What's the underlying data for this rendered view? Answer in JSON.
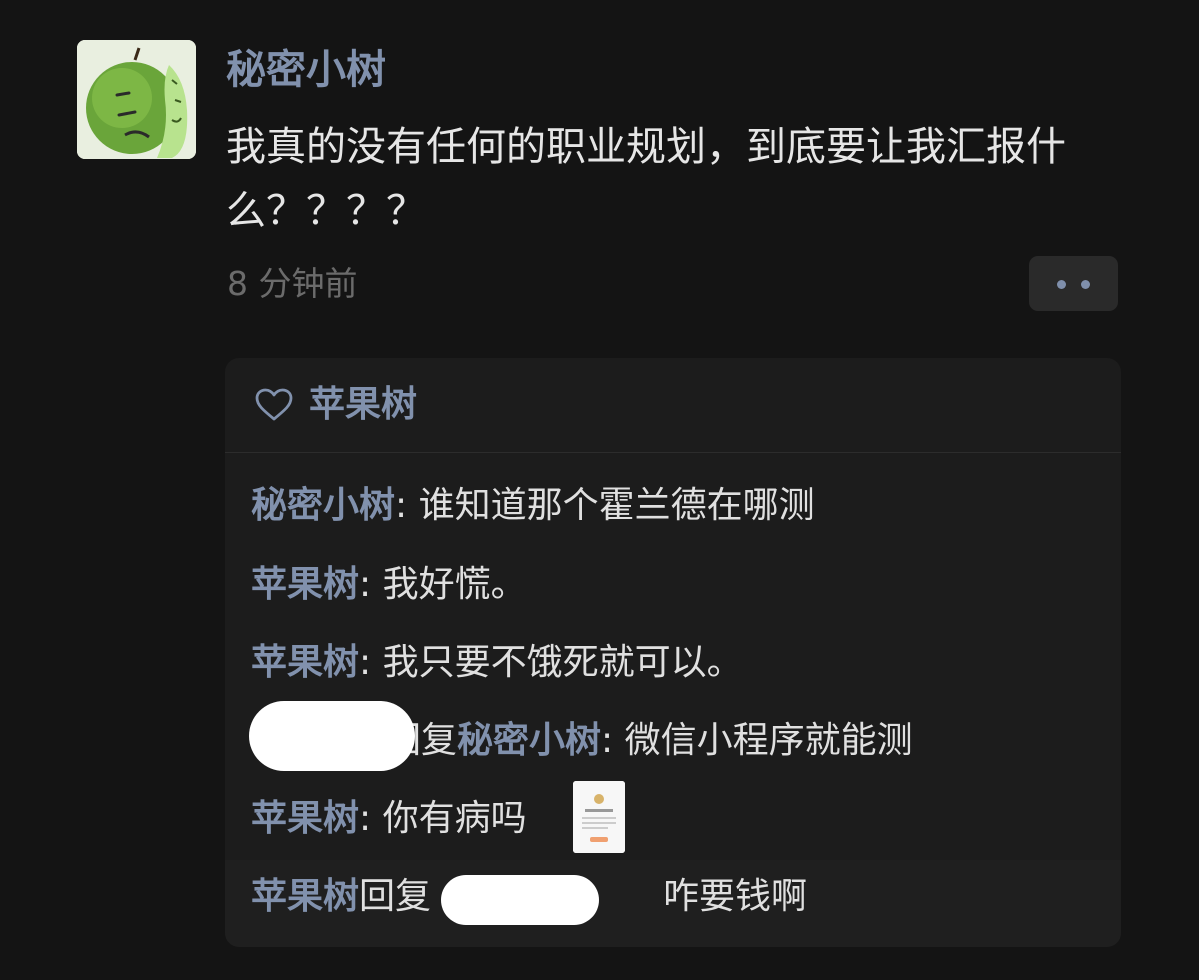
{
  "post": {
    "author": "秘密小树",
    "text": "我真的没有任何的职业规划，到底要让我汇报什么？？？？",
    "time": "8 分钟前"
  },
  "likes": {
    "names": "苹果树"
  },
  "comments": [
    {
      "name": "秘密小树",
      "sep": ": ",
      "text": "谁知道那个霍兰德在哪测"
    },
    {
      "name": "苹果树",
      "sep": ": ",
      "text": "我好慌。"
    },
    {
      "name": "苹果树",
      "sep": ": ",
      "text": "我只要不饿死就可以。"
    },
    {
      "reply_word": "回复",
      "reply_to": "秘密小树",
      "sep": ": ",
      "text": "微信小程序就能测"
    },
    {
      "name": "苹果树",
      "sep": ": ",
      "text": "你有病吗"
    },
    {
      "name": "苹果树",
      "reply_word": "回复",
      "text": "咋要钱啊"
    }
  ],
  "colors": {
    "background": "#141414",
    "name_link": "#8191ad",
    "text": "#e6e6e6",
    "muted": "#6b6b6b",
    "panel": "#1c1c1c"
  },
  "icons": [
    "apple-avatar",
    "more-dots-icon",
    "heart-icon",
    "image-thumbnail"
  ]
}
